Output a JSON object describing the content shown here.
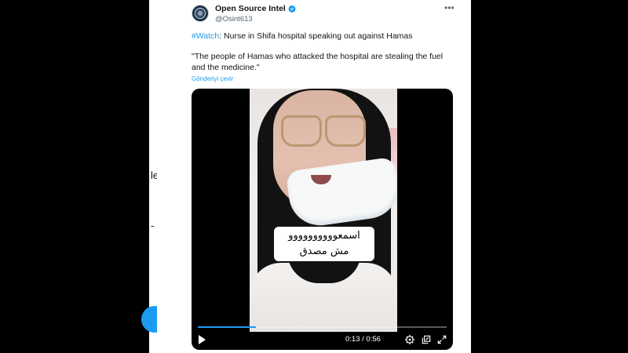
{
  "background": {
    "fragment_1": "lel",
    "fragment_2": "-"
  },
  "tweet": {
    "display_name": "Open Source Intel",
    "handle": "@Osint613",
    "hashtag": "#Watch",
    "headline": ": Nurse in Shifa hospital speaking out against Hamas",
    "quote_line_1": "\"The people of Hamas who attacked the hospital are stealing the fuel",
    "quote_line_2": "and the medicine.\"",
    "translate_label": "Gönderiyi çevir",
    "icons": {
      "verified": "verified-badge-icon",
      "more": "more-options-icon"
    }
  },
  "video": {
    "caption_line_1": "اسمعوووووووووو",
    "caption_line_2": "مش مصدق",
    "time_display": "0:13 / 0:56",
    "progress": 0.232,
    "icons": [
      "play-icon",
      "settings-icon",
      "pop-out-icon",
      "fullscreen-icon"
    ]
  },
  "colors": {
    "accent": "#1d9bf0",
    "text": "#0f1419",
    "muted": "#536471"
  }
}
